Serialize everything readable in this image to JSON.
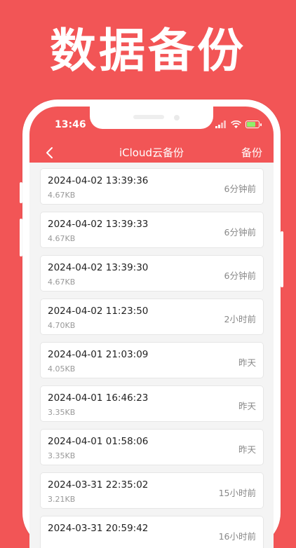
{
  "headline": "数据备份",
  "status_bar": {
    "time": "13:46"
  },
  "nav": {
    "title": "iCloud云备份",
    "action": "备份"
  },
  "colors": {
    "brand": "#f25556",
    "battery": "#8ef06b"
  },
  "backups": [
    {
      "date": "2024-04-02 13:39:36",
      "size": "4.67KB",
      "ago": "6分钟前"
    },
    {
      "date": "2024-04-02 13:39:33",
      "size": "4.67KB",
      "ago": "6分钟前"
    },
    {
      "date": "2024-04-02 13:39:30",
      "size": "4.67KB",
      "ago": "6分钟前"
    },
    {
      "date": "2024-04-02 11:23:50",
      "size": "4.70KB",
      "ago": "2小时前"
    },
    {
      "date": "2024-04-01 21:03:09",
      "size": "4.05KB",
      "ago": "昨天"
    },
    {
      "date": "2024-04-01 16:46:23",
      "size": "3.35KB",
      "ago": "昨天"
    },
    {
      "date": "2024-04-01 01:58:06",
      "size": "3.35KB",
      "ago": "昨天"
    },
    {
      "date": "2024-03-31 22:35:02",
      "size": "3.21KB",
      "ago": "15小时前"
    },
    {
      "date": "2024-03-31 20:59:42",
      "size": "",
      "ago": "16小时前"
    }
  ]
}
